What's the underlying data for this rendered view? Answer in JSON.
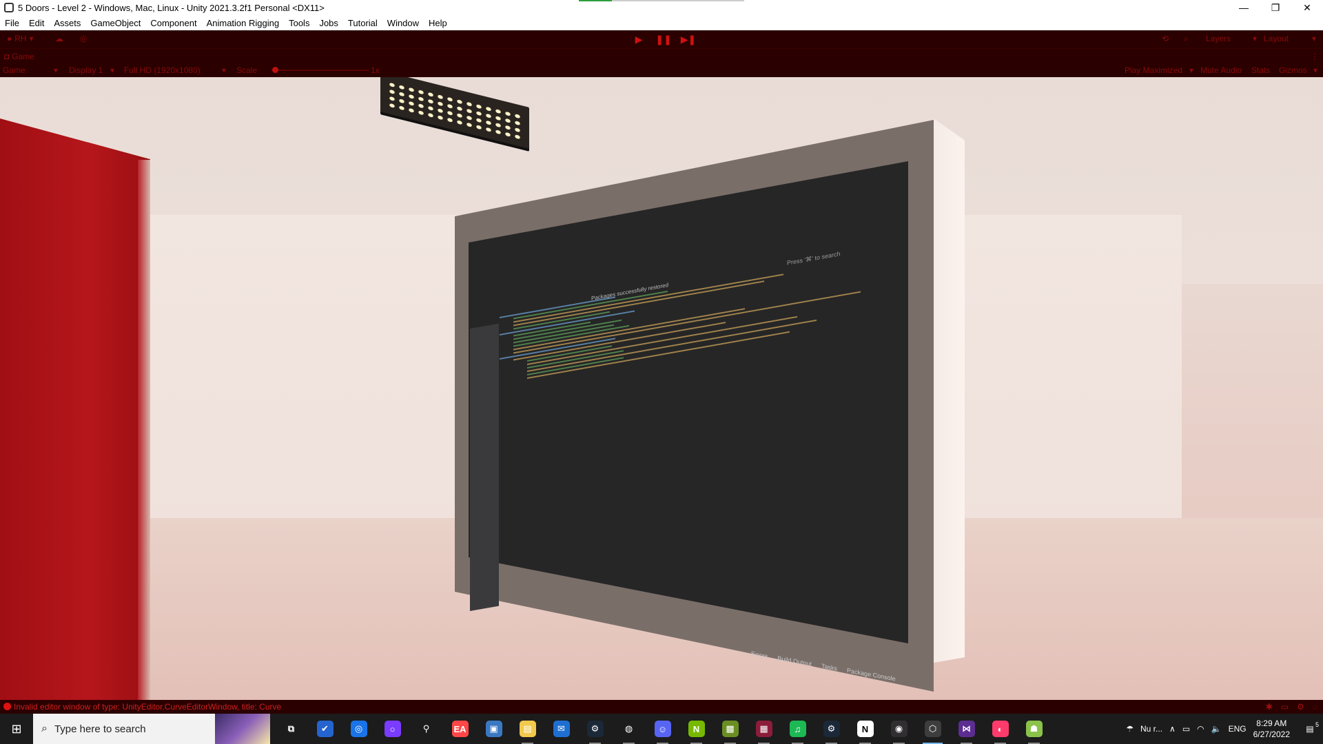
{
  "window": {
    "title": "5 Doors - Level 2 - Windows, Mac, Linux - Unity 2021.3.2f1 Personal <DX11>",
    "controls": {
      "minimize": "—",
      "restore": "❐",
      "close": "✕"
    },
    "progress": 0.2
  },
  "menu": [
    "File",
    "Edit",
    "Assets",
    "GameObject",
    "Component",
    "Animation Rigging",
    "Tools",
    "Jobs",
    "Tutorial",
    "Window",
    "Help"
  ],
  "toolbar": {
    "account": "RH",
    "layers": "Layers",
    "layout": "Layout"
  },
  "game_tab": {
    "label": "Game"
  },
  "game_bar": {
    "view": "Game",
    "display": "Display 1",
    "resolution": "Full HD (1920x1080)",
    "scale_label": "Scale",
    "scale_value": "1x",
    "play_mode": "Play Maximized",
    "mute": "Mute Audio",
    "stats": "Stats",
    "gizmos": "Gizmos"
  },
  "scene": {
    "ide": {
      "search_placeholder": "Press '⌘' to search",
      "status": "Packages successfully restored",
      "bottom_tabs": [
        "Errors",
        "Build Output",
        "Tasks",
        "Package Console"
      ],
      "side_tabs": [
        "Document Outline",
        "Tests"
      ]
    }
  },
  "console": {
    "message": "Invalid editor window of type: UnityEditor.CurveEditorWindow, title: Curve"
  },
  "taskbar": {
    "search_placeholder": "Type here to search",
    "apps": [
      {
        "name": "task-view",
        "glyph": "⧉",
        "color": "#1c1c1c"
      },
      {
        "name": "todo",
        "glyph": "✔",
        "color": "#2564cf"
      },
      {
        "name": "app-blue-circle",
        "glyph": "◎",
        "color": "#1a73e8"
      },
      {
        "name": "cortana",
        "glyph": "○",
        "color": "#7a3cff"
      },
      {
        "name": "vpn",
        "glyph": "⚲",
        "color": "#1c1c1c"
      },
      {
        "name": "ea",
        "glyph": "EA",
        "color": "#ff4747"
      },
      {
        "name": "photos",
        "glyph": "▣",
        "color": "#3b78c2"
      },
      {
        "name": "file-explorer",
        "glyph": "▤",
        "color": "#f2c94c"
      },
      {
        "name": "mail",
        "glyph": "✉",
        "color": "#1f6fd1"
      },
      {
        "name": "steam",
        "glyph": "⚙",
        "color": "#1b2838"
      },
      {
        "name": "chrome",
        "glyph": "◍",
        "color": "#1c1c1c"
      },
      {
        "name": "discord",
        "glyph": "☺",
        "color": "#5865f2"
      },
      {
        "name": "nvidia",
        "glyph": "N",
        "color": "#76b900"
      },
      {
        "name": "minecraft",
        "glyph": "▩",
        "color": "#6b8e23"
      },
      {
        "name": "winrar",
        "glyph": "▦",
        "color": "#8b1d3a"
      },
      {
        "name": "spotify",
        "glyph": "♫",
        "color": "#1db954"
      },
      {
        "name": "steam-2",
        "glyph": "⚙",
        "color": "#1b2838"
      },
      {
        "name": "notion",
        "glyph": "N",
        "color": "#ffffff"
      },
      {
        "name": "obs",
        "glyph": "◉",
        "color": "#302e31"
      },
      {
        "name": "unity",
        "glyph": "⬡",
        "color": "#3d3d3d"
      },
      {
        "name": "visual-studio",
        "glyph": "⋈",
        "color": "#5c2d91"
      },
      {
        "name": "creative-cloud",
        "glyph": "◐",
        "color": "#ff3b6b"
      },
      {
        "name": "android-app",
        "glyph": "☗",
        "color": "#8bc34a"
      }
    ],
    "weather": "Nu r...",
    "language": "ENG",
    "time": "8:29 AM",
    "date": "6/27/2022",
    "notifications": "5"
  }
}
